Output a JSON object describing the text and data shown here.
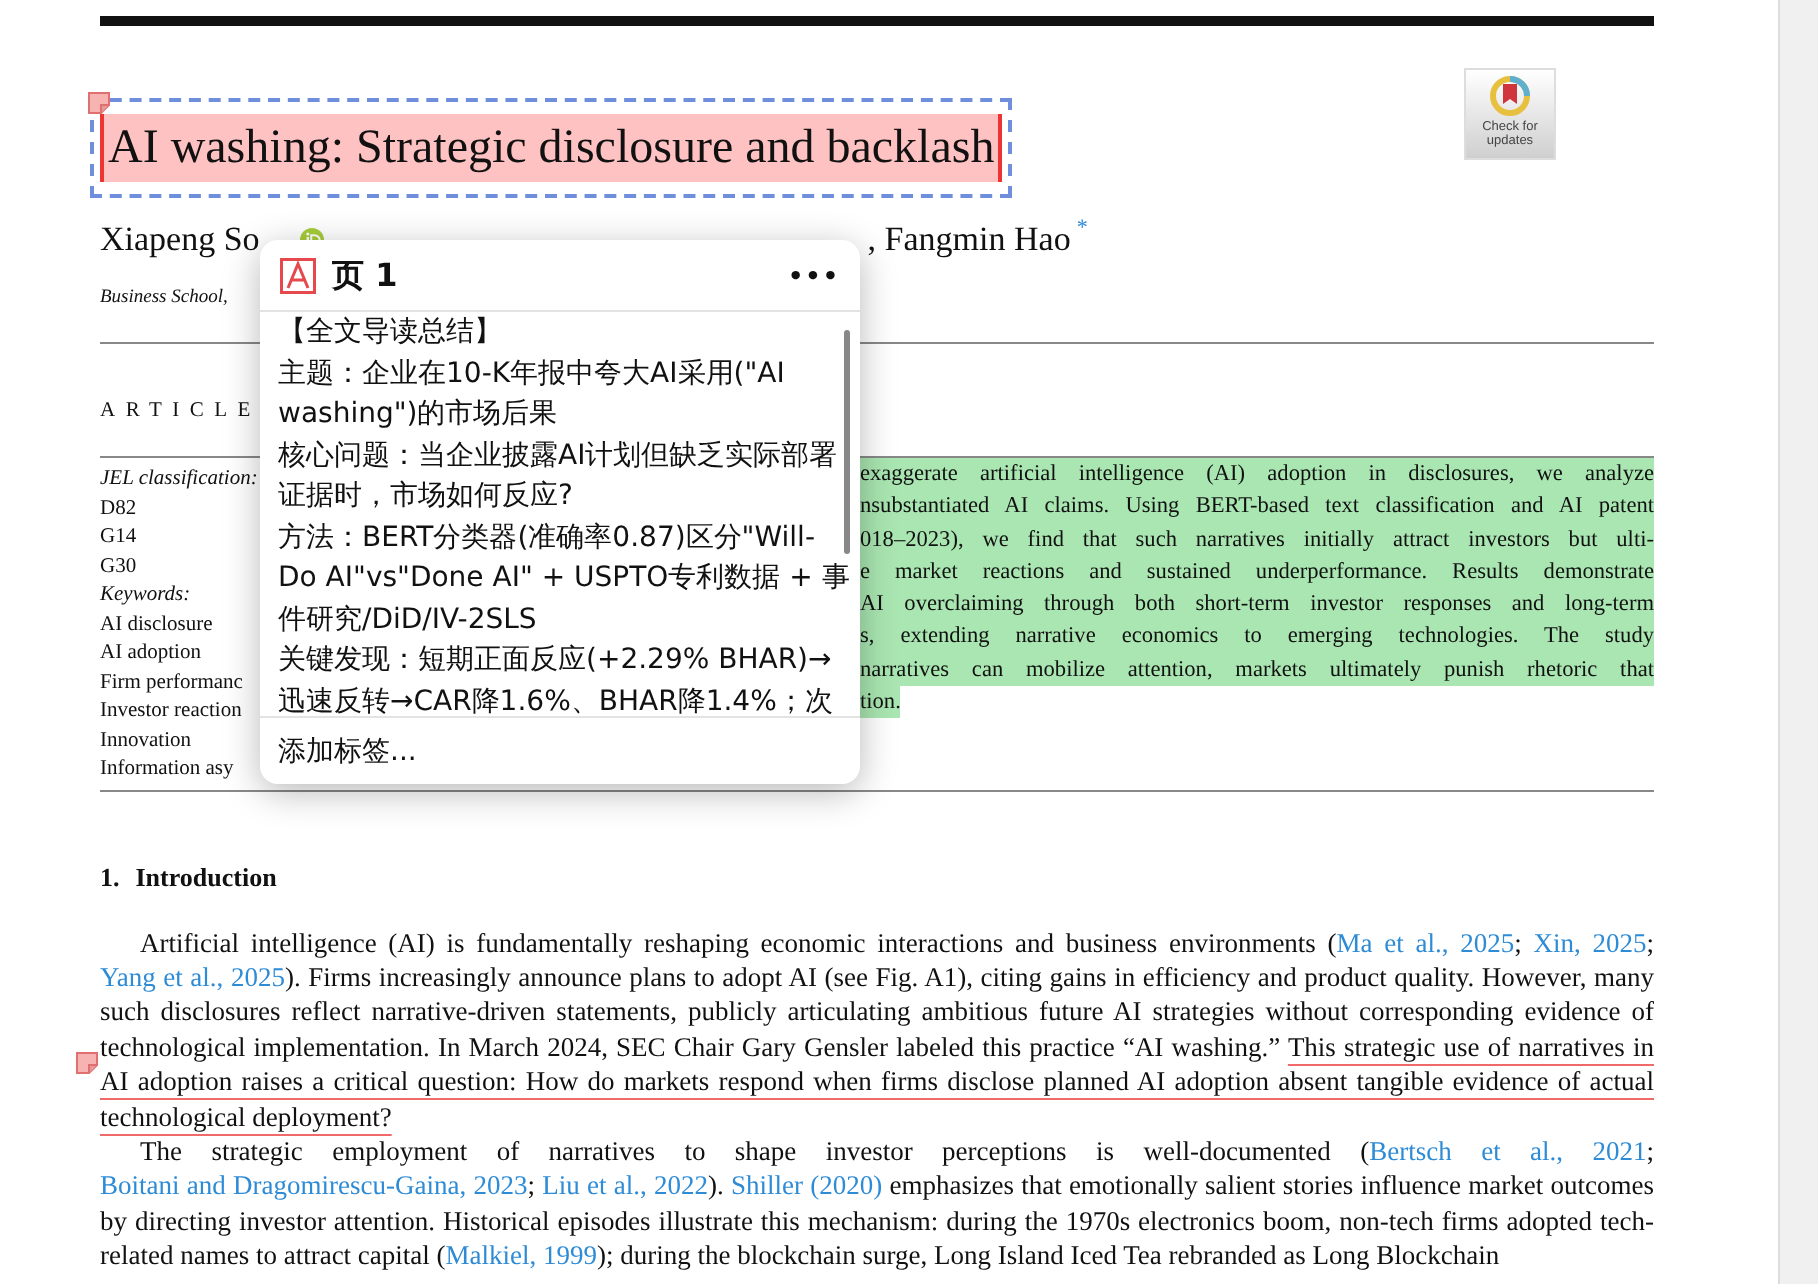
{
  "page": {
    "check_for_updates": {
      "lines": [
        "Check for",
        "updates"
      ]
    },
    "title": {
      "text": "AI washing: Strategic disclosure and backlash",
      "highlighted": true,
      "selected": true
    },
    "authors": {
      "first": "Xiapeng So",
      "last": ", Fangmin Hao",
      "mark": "*"
    },
    "affiliation": "Business School,",
    "article_heading": "ARTICLE",
    "keywords_column": [
      {
        "text": "JEL classification:",
        "kind": "heading"
      },
      {
        "text": "D82",
        "kind": "item"
      },
      {
        "text": "G14",
        "kind": "item"
      },
      {
        "text": "G30",
        "kind": "item"
      },
      {
        "text": "Keywords:",
        "kind": "heading"
      },
      {
        "text": "AI disclosure",
        "kind": "item"
      },
      {
        "text": "AI adoption",
        "kind": "item"
      },
      {
        "text": "Firm performanc",
        "kind": "item"
      },
      {
        "text": "Investor reaction",
        "kind": "item"
      },
      {
        "text": "Innovation",
        "kind": "item"
      },
      {
        "text": "Information asy",
        "kind": "item"
      }
    ],
    "abstract_lines": [
      {
        "text": "exaggerate artificial intelligence (AI) adoption in disclosures, we analyze",
        "highlighted": true
      },
      {
        "text": "nsubstantiated AI claims. Using BERT-based text classification and AI patent",
        "highlighted": true
      },
      {
        "text": "018–2023), we find that such narratives initially attract investors but ulti-",
        "highlighted": true
      },
      {
        "text": "e market reactions and sustained underperformance. Results demonstrate",
        "highlighted": true
      },
      {
        "text": "AI overclaiming through both short-term investor responses and long-term",
        "highlighted": true
      },
      {
        "text": "s, extending narrative economics to emerging technologies. The study",
        "highlighted": true
      },
      {
        "text": "narratives can mobilize attention, markets ultimately punish rhetoric that",
        "highlighted": true
      },
      {
        "text": "tion.",
        "highlighted": true
      }
    ],
    "section": {
      "number": "1.",
      "title": "Introduction"
    },
    "paragraphs": [
      [
        {
          "kind": "text",
          "text": "Artificial intelligence (AI) is fundamentally reshaping economic interactions and business environments ("
        },
        {
          "kind": "link",
          "text": "Ma et al., 2025"
        },
        {
          "kind": "text",
          "text": "; "
        },
        {
          "kind": "link",
          "text": "Xin, 2025"
        },
        {
          "kind": "text",
          "text": "; "
        },
        {
          "kind": "link",
          "text": "Yang et al., 2025"
        },
        {
          "kind": "text",
          "text": "). Firms increasingly announce plans to adopt AI (see Fig. A1), citing gains in efficiency and product quality. However, many such disclosures reflect narrative-driven statements, publicly articulating ambitious future AI strategies without corresponding evidence of technological implementation. In March 2024, SEC Chair Gary Gensler labeled this practice “AI washing.” "
        },
        {
          "kind": "underlined",
          "text": "This strategic use of narratives in AI adoption raises a critical question: How do markets respond when firms disclose planned AI adoption absent tangible evidence of actual technological deployment?"
        }
      ],
      [
        {
          "kind": "text",
          "text": "The strategic employment of narratives to shape investor perceptions is well-documented ("
        },
        {
          "kind": "link",
          "text": "Bertsch et al., 2021"
        },
        {
          "kind": "text",
          "text": "; "
        },
        {
          "kind": "link",
          "text": "Boitani and Dragomirescu-Gaina, 2023"
        },
        {
          "kind": "text",
          "text": "; "
        },
        {
          "kind": "link",
          "text": "Liu et al., 2022"
        },
        {
          "kind": "text",
          "text": "). "
        },
        {
          "kind": "link",
          "text": "Shiller (2020)"
        },
        {
          "kind": "text",
          "text": " emphasizes that emotionally salient stories influence market outcomes by directing investor attention. Historical episodes illustrate this mechanism: during the 1970s electronics boom, non-tech firms adopted tech-related names to attract capital ("
        },
        {
          "kind": "link",
          "text": "Malkiel, 1999"
        },
        {
          "kind": "text",
          "text": "); during the blockchain surge, Long Island Iced Tea rebranded as Long Blockchain"
        }
      ]
    ]
  },
  "annotation_popup": {
    "page_label": "页 1",
    "menu": "•••",
    "summary": [
      "【全文导读总结】",
      "主题：企业在10-K年报中夸大AI采用(\"AI washing\")的市场后果",
      "核心问题：当企业披露AI计划但缺乏实际部署证据时，市场如何反应?",
      "方法：BERT分类器(准确率0.87)区分\"Will-Do AI\"vs\"Done AI\" + USPTO专利数据 + 事件研究/DiD/IV-2SLS",
      "关键发现：短期正面反应(+2.29% BHAR)→迅速反转→CAR降1.6%、BHAR降1.4%；次"
    ],
    "footer": "添加标签..."
  }
}
